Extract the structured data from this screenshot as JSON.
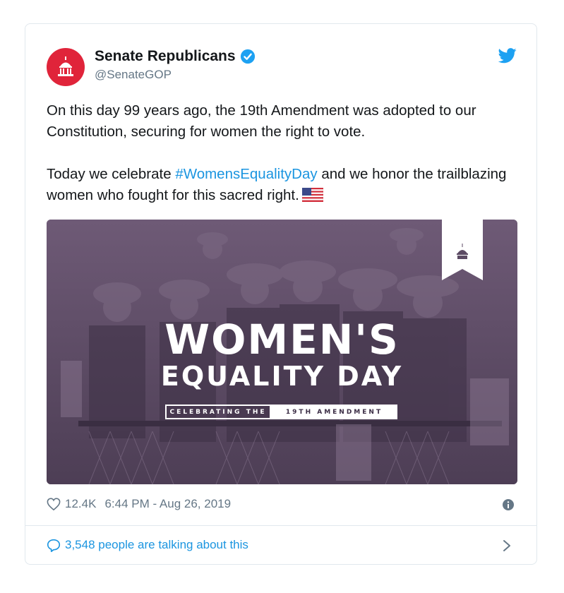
{
  "tweet": {
    "display_name": "Senate Republicans",
    "handle": "@SenateGOP",
    "paragraph1": "On this day 99 years ago, the 19th Amendment was adopted to our Constitution, securing for women the right to vote.",
    "paragraph2_pre": "Today we celebrate ",
    "hashtag": "#WomensEqualityDay",
    "paragraph2_post": " and we honor the trailblazing women who fought for this sacred right."
  },
  "media": {
    "title_line1": "WOMEN'S",
    "title_line2": "EQUALITY DAY",
    "sub_left": "CELEBRATING THE",
    "sub_right": "19TH AMENDMENT"
  },
  "footer": {
    "likes": "12.4K",
    "timestamp": "6:44 PM - Aug 26, 2019",
    "talking": "3,548 people are talking about this"
  },
  "icons": {
    "verified": "verified-badge-icon",
    "bird": "twitter-bird-icon",
    "heart": "heart-icon",
    "info": "info-icon",
    "comment": "comment-bubble-icon",
    "chevron": "chevron-right-icon"
  },
  "colors": {
    "brand_red": "#e0243a",
    "link_blue": "#1b95e0",
    "muted": "#657786",
    "media_purple": "#5b4a63"
  }
}
